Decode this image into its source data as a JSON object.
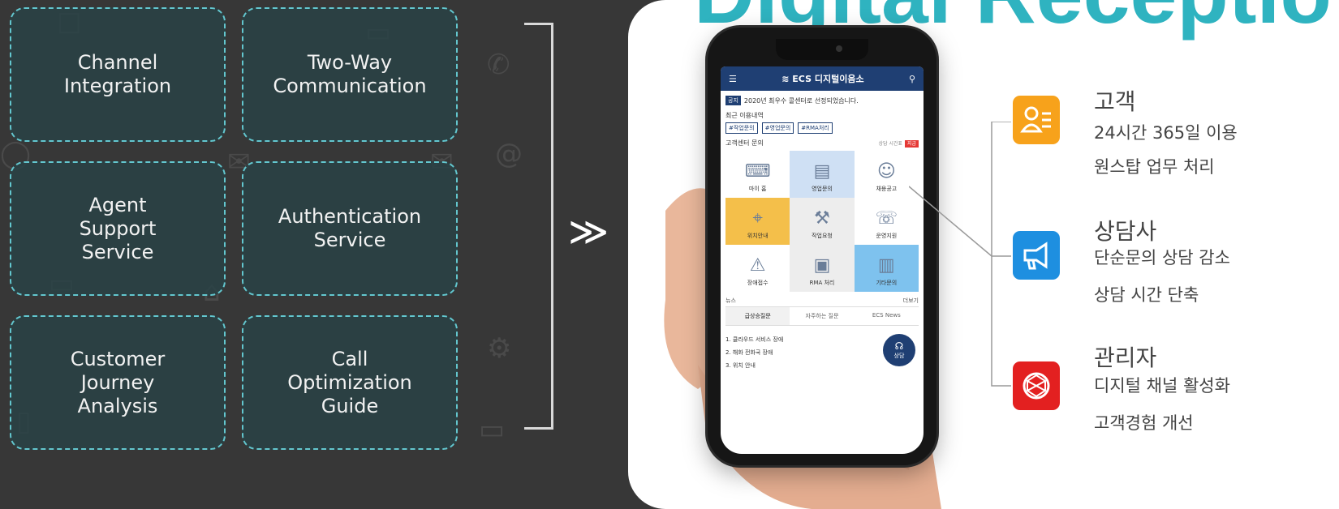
{
  "services": [
    {
      "label": "Channel\nIntegration"
    },
    {
      "label": "Two-Way\nCommunication"
    },
    {
      "label": "Agent\nSupport\nService"
    },
    {
      "label": "Authentication\nService"
    },
    {
      "label": "Customer\nJourney\nAnalysis"
    },
    {
      "label": "Call\nOptimization\nGuide"
    }
  ],
  "arrow_glyph": "≫",
  "panel": {
    "title_partial": "Digital Receptio"
  },
  "app": {
    "menu_icon": "hamburger-icon",
    "brand": "≋ ECS 디지털이음소",
    "search_icon": "search-icon",
    "notice_tag": "공지",
    "notice_text": "2020년 최우수 콜센터로 선정되었습니다.",
    "recent_label": "최근 이용내역",
    "chips": [
      "#작업문의",
      "#영업문의",
      "#RMA처리"
    ],
    "cs_label": "고객센터 문의",
    "cs_right": "상담 시간표",
    "cs_live": "지금",
    "grid": [
      {
        "label": "마이 홈",
        "badge": "New"
      },
      {
        "label": "영업문의"
      },
      {
        "label": "채용공고"
      },
      {
        "label": "위치안내"
      },
      {
        "label": "작업요청"
      },
      {
        "label": "운영지원"
      },
      {
        "label": "장애접수"
      },
      {
        "label": "RMA 처리"
      },
      {
        "label": "기타문의"
      }
    ],
    "news_label": "뉴스",
    "news_more": "더보기",
    "tabs": [
      "급상승질문",
      "자주하는 질문",
      "ECS News"
    ],
    "list": [
      "1. 클라우드 서비스 장애",
      "2. 해화 전화국 장애",
      "3. 위치 안내"
    ],
    "consult_label": "상담"
  },
  "features": [
    {
      "icon": "user-list-icon",
      "color": "#f7a21b",
      "title": "고객",
      "lines": [
        "24시간 365일 이용",
        "원스탑 업무 처리"
      ]
    },
    {
      "icon": "megaphone-icon",
      "color": "#1e8fe0",
      "title": "상담사",
      "lines": [
        "단순문의 상담 감소",
        "상담 시간 단축"
      ]
    },
    {
      "icon": "globe-network-icon",
      "color": "#e32020",
      "title": "관리자",
      "lines": [
        "디지털 채널 활성화",
        "고객경험 개선"
      ]
    }
  ]
}
